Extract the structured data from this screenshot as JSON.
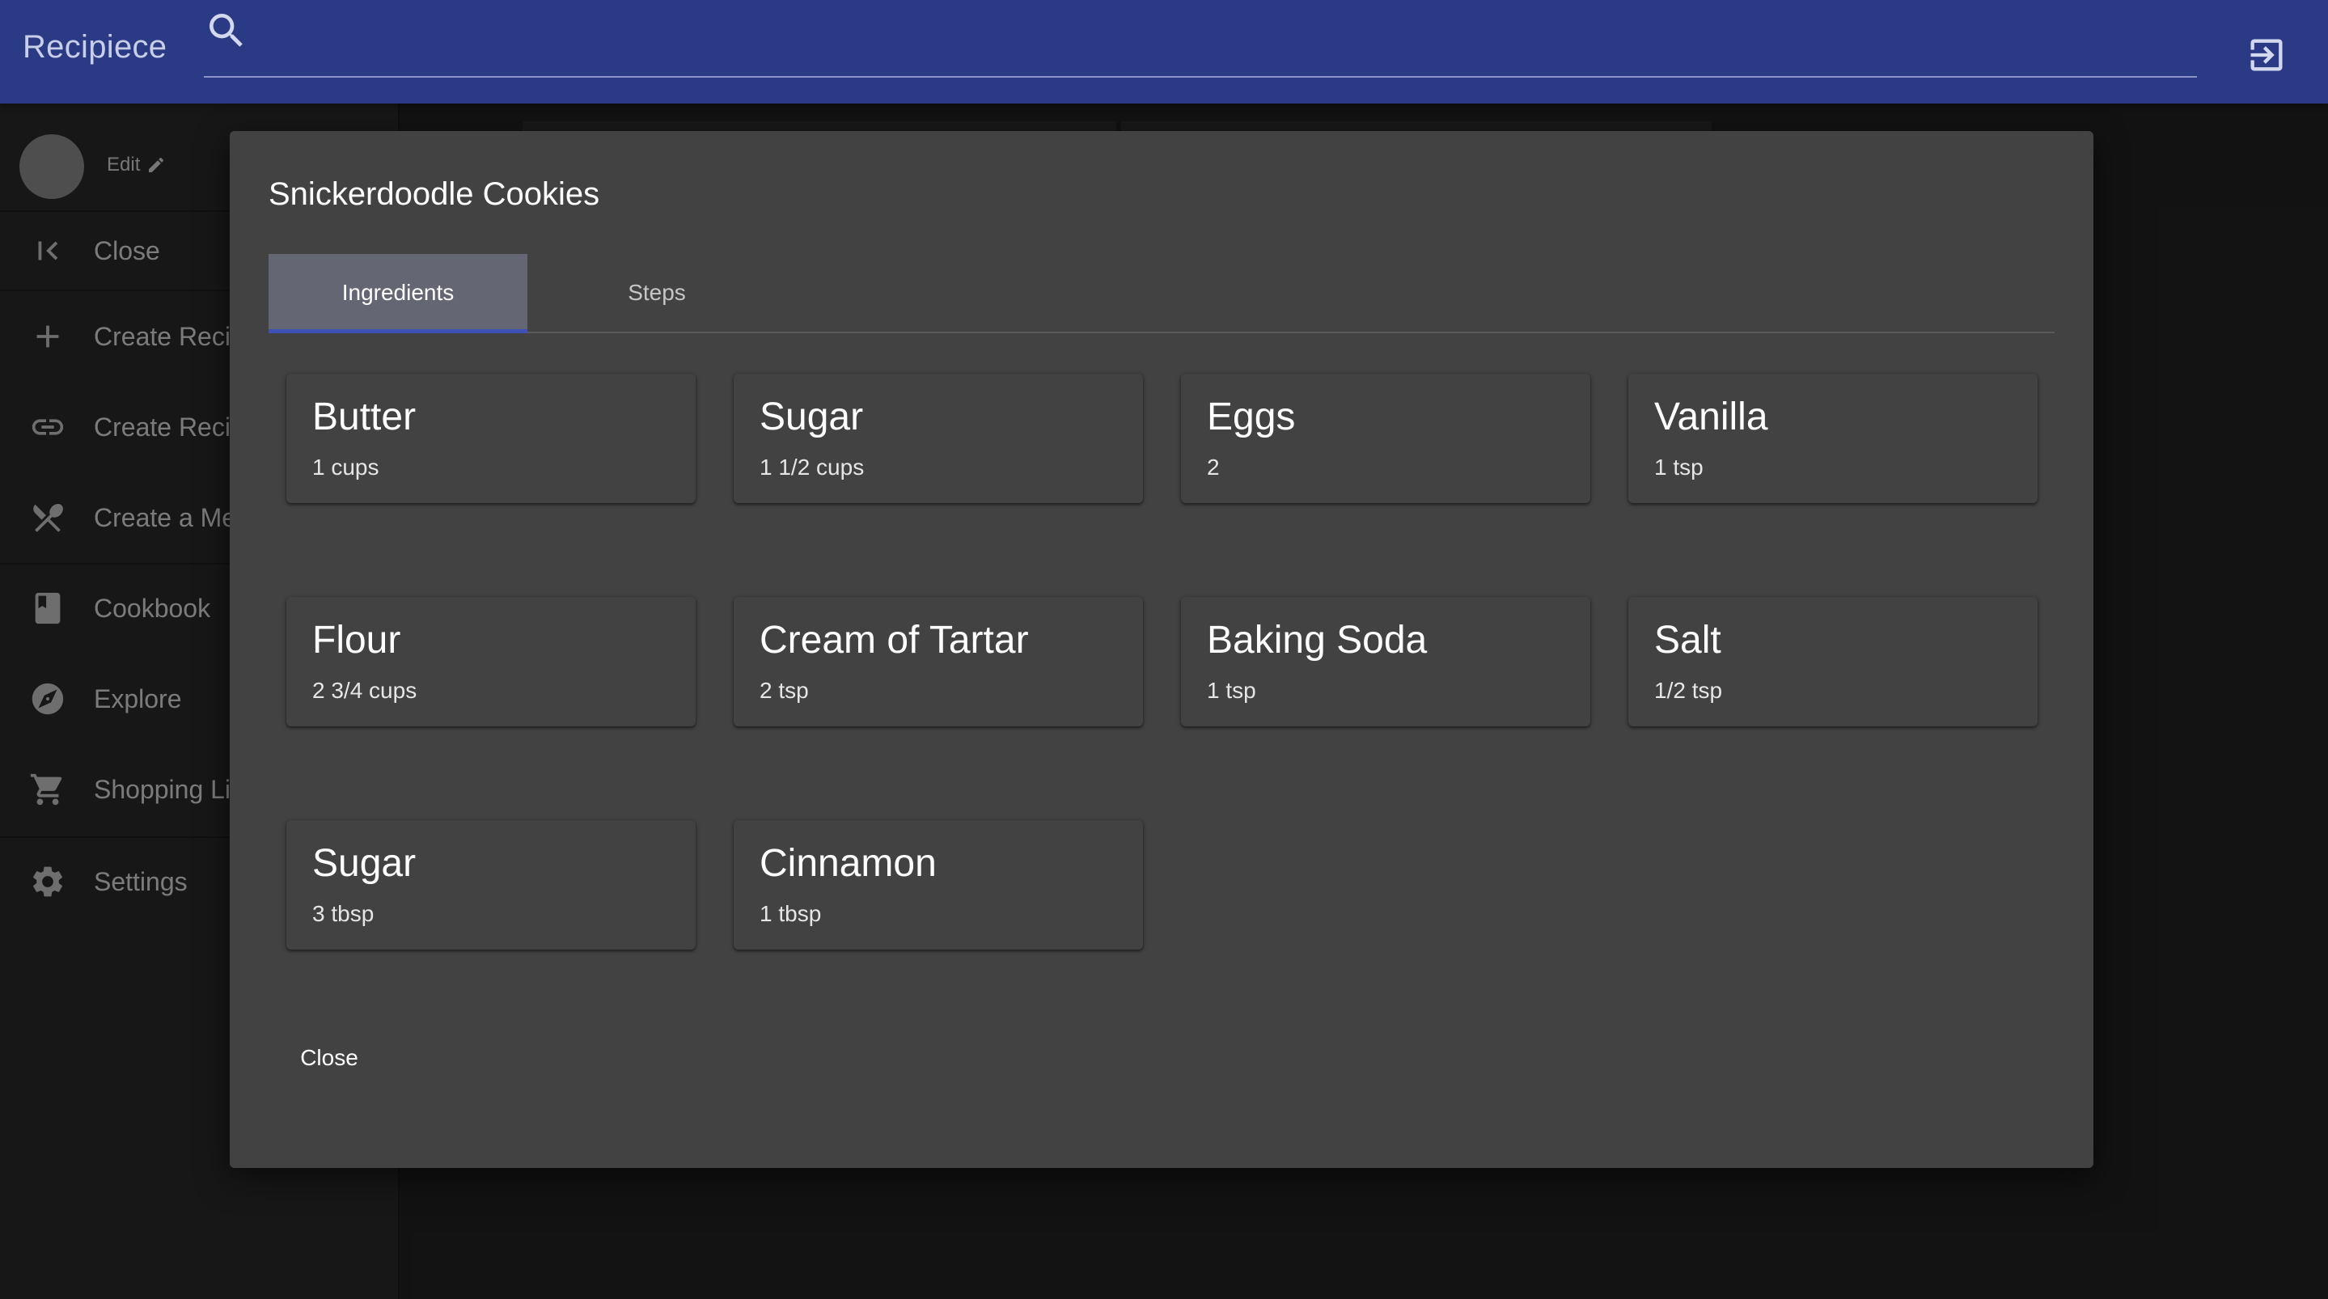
{
  "app": {
    "title": "Recipiece"
  },
  "search": {
    "value": "",
    "placeholder": ""
  },
  "sidebar": {
    "edit_label": "Edit",
    "items": [
      {
        "label": "Close",
        "icon": "first-page-icon"
      },
      {
        "label": "Create Reci",
        "icon": "plus-icon"
      },
      {
        "label": "Create Reci",
        "icon": "link-icon"
      },
      {
        "label": "Create a Me",
        "icon": "utensils-icon"
      },
      {
        "label": "Cookbook",
        "icon": "book-icon"
      },
      {
        "label": "Explore",
        "icon": "compass-icon"
      },
      {
        "label": "Shopping Li",
        "icon": "cart-icon"
      },
      {
        "label": "Settings",
        "icon": "gear-icon"
      }
    ]
  },
  "modal": {
    "title": "Snickerdoodle Cookies",
    "tabs": [
      {
        "label": "Ingredients",
        "active": true
      },
      {
        "label": "Steps",
        "active": false
      }
    ],
    "ingredients": [
      {
        "name": "Butter",
        "qty": "1 cups"
      },
      {
        "name": "Sugar",
        "qty": "1 1/2 cups"
      },
      {
        "name": "Eggs",
        "qty": "2"
      },
      {
        "name": "Vanilla",
        "qty": "1 tsp"
      },
      {
        "name": "Flour",
        "qty": "2 3/4 cups"
      },
      {
        "name": "Cream of Tartar",
        "qty": "2 tsp"
      },
      {
        "name": "Baking Soda",
        "qty": "1 tsp"
      },
      {
        "name": "Salt",
        "qty": "1/2 tsp"
      },
      {
        "name": "Sugar",
        "qty": "3 tbsp"
      },
      {
        "name": "Cinnamon",
        "qty": "1 tbsp"
      }
    ],
    "close_label": "Close"
  },
  "colors": {
    "appbar": "#2a3a85",
    "modal": "#424242",
    "tab_active": "#656673",
    "tab_indicator": "#3f51b5"
  }
}
